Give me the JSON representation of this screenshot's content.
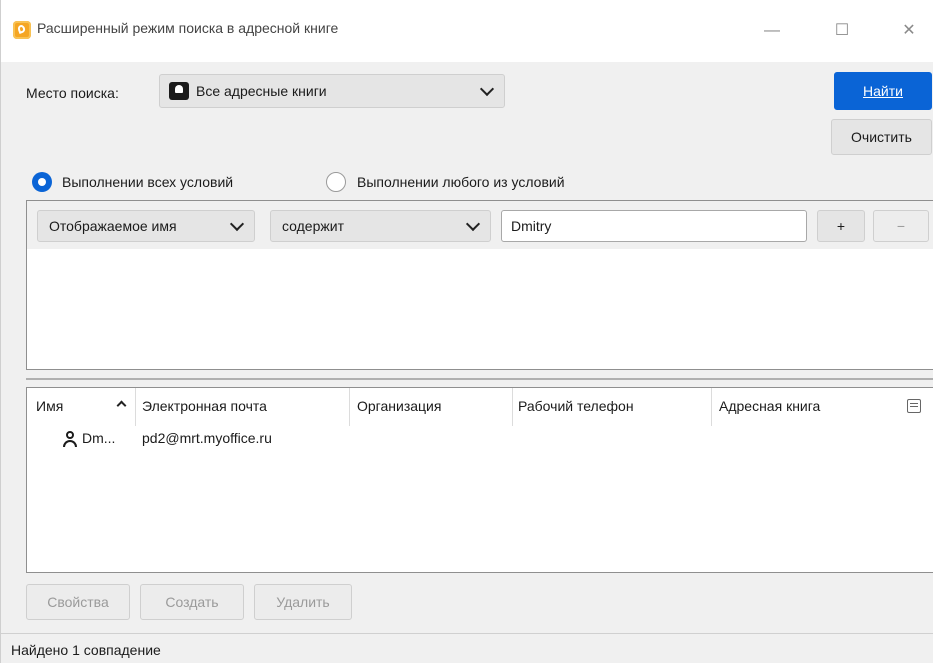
{
  "window": {
    "title": "Расширенный режим поиска в адресной книге",
    "minimize": "—",
    "maximize": "☐",
    "close": "✕"
  },
  "search": {
    "location_label": "Место поиска:",
    "location_value": "Все адресные книги",
    "find_button": "Найти",
    "clear_button": "Очистить"
  },
  "match_mode": {
    "all_label": "Выполнении всех условий",
    "any_label": "Выполнении любого из условий",
    "selected": "all"
  },
  "condition": {
    "field": "Отображаемое имя",
    "operator": "содержит",
    "value": "Dmitry",
    "add_label": "+",
    "remove_label": "−"
  },
  "results": {
    "columns": [
      "Имя",
      "Электронная почта",
      "Организация",
      "Рабочий телефон",
      "Адресная книга"
    ],
    "sort_indicator": "^",
    "rows": [
      {
        "name": "Dm...",
        "email": "pd2@mrt.myoffice.ru",
        "organization": "",
        "work_phone": "",
        "address_book": ""
      }
    ]
  },
  "actions": {
    "properties": "Свойства",
    "create": "Создать",
    "delete": "Удалить"
  },
  "status": {
    "text": "Найдено 1 совпадение"
  },
  "colors": {
    "accent": "#0a64d6",
    "app_icon": "#f5a623"
  }
}
